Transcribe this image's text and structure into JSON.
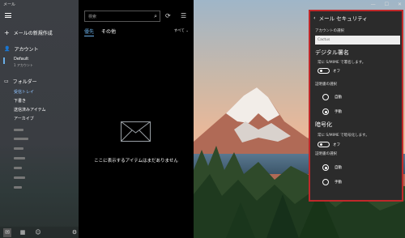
{
  "window": {
    "title": "メール",
    "minimize_glyph": "—",
    "maximize_glyph": "☐",
    "close_glyph": "✕"
  },
  "nav": {
    "menu_icon": "hamburger-icon",
    "new_mail_label": "メールの新規作成",
    "accounts_label": "アカウント",
    "account": {
      "name": "Default",
      "sub": "1 アカウント"
    },
    "folders_label": "フォルダー",
    "folders": [
      "受信トレイ",
      "下書き",
      "送信済みアイテム",
      "アーカイブ"
    ],
    "bottom_icons": [
      "mail-icon",
      "calendar-icon",
      "people-icon",
      "settings-icon"
    ],
    "accent_color": "#6aaee6"
  },
  "list": {
    "search_placeholder": "検索",
    "tab_focused": "優先",
    "tab_other": "その他",
    "filter_label": "すべて",
    "empty_message": "ここに表示するアイテムはまだありません"
  },
  "security": {
    "back_glyph": "‹",
    "title": "メール セキュリティ",
    "account_select_label": "アカウントの選択",
    "account_selected": "Cactus",
    "signing": {
      "heading": "デジタル署名",
      "always_label": "常に S/MIME で署名します。",
      "toggle_label": "オフ",
      "cert_label": "証明書の選択",
      "options": [
        "自動",
        "手動"
      ],
      "selected_index": 1
    },
    "encryption": {
      "heading": "暗号化",
      "always_label": "常に S/MIME で暗号化します。",
      "toggle_label": "オフ",
      "cert_label": "証明書の選択",
      "options": [
        "自動",
        "手動"
      ],
      "selected_index": 0
    },
    "border_color": "#c0282a"
  }
}
